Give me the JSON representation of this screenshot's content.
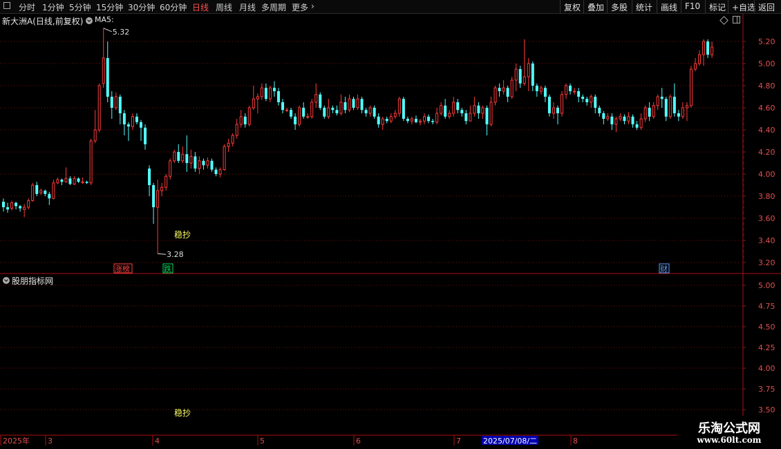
{
  "toolbar": {
    "periods": [
      "分时",
      "1分钟",
      "5分钟",
      "15分钟",
      "30分钟",
      "60分钟",
      "日线",
      "周线",
      "月线",
      "多周期",
      "更多"
    ],
    "active_period": "日线",
    "more_arrow": "›",
    "right_buttons": [
      "复权",
      "叠加",
      "多股",
      "统计",
      "画线",
      "F10",
      "标记",
      "+自选",
      "返回"
    ]
  },
  "main_panel": {
    "title": "新大洲A(日线,前复权)",
    "ma_label": "MA5:",
    "y_ticks": [
      "5.20",
      "5.00",
      "4.80",
      "4.60",
      "4.40",
      "4.20",
      "4.00",
      "3.80",
      "3.60",
      "3.40",
      "3.20"
    ],
    "high_marker": "5.32",
    "low_marker": "3.28",
    "signal_label": "稳抄",
    "badges": [
      {
        "text": "涨榜",
        "color": "#ff4040"
      },
      {
        "text": "跌",
        "color": "#00e060"
      },
      {
        "text": "财",
        "color": "#60a0ff"
      }
    ]
  },
  "sub_panel": {
    "title": "股朋指标网",
    "y_ticks": [
      "5.00",
      "4.75",
      "4.50",
      "4.25",
      "4.00",
      "3.75",
      "3.50"
    ],
    "signal_label": "稳抄"
  },
  "date_axis": {
    "labels": [
      "2025年",
      "3",
      "4",
      "5",
      "6",
      "7",
      "8"
    ],
    "cursor_date": "2025/07/08/二"
  },
  "watermark": {
    "line1": "乐淘公式网",
    "line2": "www.60lt.com"
  },
  "colors": {
    "up": "#ff3c3c",
    "down": "#54ffff",
    "grid": "#7a1010",
    "signal": "#ffff66"
  },
  "chart_data": {
    "type": "candlestick",
    "y_range": [
      3.1,
      5.35
    ],
    "candles": [
      [
        3.75,
        3.7,
        3.78,
        3.66
      ],
      [
        3.7,
        3.68,
        3.74,
        3.65
      ],
      [
        3.69,
        3.74,
        3.76,
        3.67
      ],
      [
        3.74,
        3.71,
        3.75,
        3.68
      ],
      [
        3.71,
        3.69,
        3.72,
        3.66
      ],
      [
        3.68,
        3.7,
        3.73,
        3.61
      ],
      [
        3.7,
        3.76,
        3.78,
        3.68
      ],
      [
        3.76,
        3.9,
        3.92,
        3.75
      ],
      [
        3.9,
        3.82,
        3.93,
        3.8
      ],
      [
        3.83,
        3.85,
        3.87,
        3.81
      ],
      [
        3.85,
        3.82,
        3.86,
        3.8
      ],
      [
        3.82,
        3.78,
        3.84,
        3.72
      ],
      [
        3.78,
        3.92,
        3.95,
        3.77
      ],
      [
        3.92,
        3.95,
        3.97,
        3.91
      ],
      [
        3.95,
        3.93,
        3.96,
        3.9
      ],
      [
        3.93,
        3.96,
        4.06,
        3.92
      ],
      [
        3.96,
        3.91,
        3.98,
        3.9
      ],
      [
        3.91,
        3.96,
        3.98,
        3.9
      ],
      [
        3.96,
        3.93,
        3.97,
        3.92
      ],
      [
        3.93,
        3.93,
        3.97,
        3.91
      ],
      [
        3.93,
        3.92,
        3.94,
        3.91
      ],
      [
        3.92,
        4.3,
        4.32,
        3.9
      ],
      [
        4.3,
        4.4,
        4.58,
        4.28
      ],
      [
        4.4,
        4.8,
        4.82,
        4.38
      ],
      [
        4.82,
        5.05,
        5.32,
        4.78
      ],
      [
        5.05,
        4.7,
        5.2,
        4.65
      ],
      [
        4.7,
        4.6,
        4.75,
        4.5
      ],
      [
        4.6,
        4.7,
        4.74,
        4.58
      ],
      [
        4.7,
        4.55,
        4.72,
        4.45
      ],
      [
        4.55,
        4.45,
        4.58,
        4.35
      ],
      [
        4.45,
        4.43,
        4.47,
        4.3
      ],
      [
        4.43,
        4.52,
        4.55,
        4.4
      ],
      [
        4.52,
        4.47,
        4.55,
        4.45
      ],
      [
        4.47,
        4.42,
        4.49,
        4.3
      ],
      [
        4.42,
        4.27,
        4.45,
        4.22
      ],
      [
        4.05,
        3.9,
        4.08,
        3.8
      ],
      [
        3.9,
        3.7,
        3.92,
        3.55
      ],
      [
        3.7,
        3.85,
        3.95,
        3.28
      ],
      [
        3.85,
        3.88,
        3.92,
        3.8
      ],
      [
        3.88,
        3.98,
        4.0,
        3.85
      ],
      [
        3.98,
        4.12,
        4.14,
        3.95
      ],
      [
        4.12,
        4.2,
        4.22,
        4.1
      ],
      [
        4.2,
        4.12,
        4.27,
        4.1
      ],
      [
        4.12,
        4.18,
        4.25,
        4.1
      ],
      [
        4.18,
        4.1,
        4.35,
        4.02
      ],
      [
        4.1,
        4.16,
        4.22,
        4.05
      ],
      [
        4.16,
        4.05,
        4.2,
        4.02
      ],
      [
        4.05,
        4.12,
        4.16,
        4.0
      ],
      [
        4.12,
        4.08,
        4.14,
        4.04
      ],
      [
        4.08,
        4.12,
        4.15,
        4.05
      ],
      [
        4.12,
        4.04,
        4.14,
        4.02
      ],
      [
        4.04,
        4.0,
        4.06,
        3.98
      ],
      [
        4.0,
        4.04,
        4.06,
        3.97
      ],
      [
        4.04,
        4.25,
        4.27,
        4.03
      ],
      [
        4.25,
        4.28,
        4.32,
        4.2
      ],
      [
        4.28,
        4.35,
        4.37,
        4.25
      ],
      [
        4.35,
        4.45,
        4.5,
        4.32
      ],
      [
        4.45,
        4.52,
        4.58,
        4.42
      ],
      [
        4.52,
        4.45,
        4.55,
        4.42
      ],
      [
        4.45,
        4.6,
        4.62,
        4.43
      ],
      [
        4.6,
        4.68,
        4.8,
        4.58
      ],
      [
        4.68,
        4.7,
        4.73,
        4.55
      ],
      [
        4.7,
        4.78,
        4.82,
        4.67
      ],
      [
        4.78,
        4.68,
        4.82,
        4.66
      ],
      [
        4.68,
        4.78,
        4.8,
        4.65
      ],
      [
        4.78,
        4.75,
        4.84,
        4.7
      ],
      [
        4.75,
        4.65,
        4.78,
        4.62
      ],
      [
        4.65,
        4.58,
        4.68,
        4.55
      ],
      [
        4.58,
        4.58,
        4.6,
        4.56
      ],
      [
        4.58,
        4.52,
        4.6,
        4.5
      ],
      [
        4.52,
        4.45,
        4.55,
        4.4
      ],
      [
        4.45,
        4.6,
        4.62,
        4.43
      ],
      [
        4.6,
        4.52,
        4.65,
        4.5
      ],
      [
        4.52,
        4.52,
        4.55,
        4.5
      ],
      [
        4.52,
        4.65,
        4.68,
        4.5
      ],
      [
        4.65,
        4.72,
        4.82,
        4.6
      ],
      [
        4.72,
        4.6,
        4.74,
        4.58
      ],
      [
        4.6,
        4.52,
        4.62,
        4.5
      ],
      [
        4.52,
        4.6,
        4.68,
        4.5
      ],
      [
        4.6,
        4.58,
        4.62,
        4.55
      ],
      [
        4.58,
        4.55,
        4.62,
        4.53
      ],
      [
        4.55,
        4.65,
        4.72,
        4.53
      ],
      [
        4.65,
        4.58,
        4.7,
        4.55
      ],
      [
        4.58,
        4.68,
        4.72,
        4.56
      ],
      [
        4.68,
        4.6,
        4.7,
        4.58
      ],
      [
        4.6,
        4.68,
        4.72,
        4.58
      ],
      [
        4.68,
        4.58,
        4.7,
        4.55
      ],
      [
        4.58,
        4.55,
        4.6,
        4.52
      ],
      [
        4.55,
        4.6,
        4.62,
        4.52
      ],
      [
        4.6,
        4.52,
        4.62,
        4.5
      ],
      [
        4.52,
        4.45,
        4.55,
        4.42
      ],
      [
        4.45,
        4.5,
        4.52,
        4.4
      ],
      [
        4.5,
        4.48,
        4.52,
        4.46
      ],
      [
        4.48,
        4.52,
        4.55,
        4.46
      ],
      [
        4.52,
        4.55,
        4.58,
        4.5
      ],
      [
        4.55,
        4.68,
        4.7,
        4.52
      ],
      [
        4.68,
        4.5,
        4.7,
        4.48
      ],
      [
        4.5,
        4.48,
        4.52,
        4.46
      ],
      [
        4.48,
        4.5,
        4.52,
        4.45
      ],
      [
        4.5,
        4.47,
        4.53,
        4.46
      ],
      [
        4.47,
        4.48,
        4.5,
        4.44
      ],
      [
        4.48,
        4.52,
        4.55,
        4.45
      ],
      [
        4.52,
        4.48,
        4.54,
        4.46
      ],
      [
        4.48,
        4.47,
        4.5,
        4.45
      ],
      [
        4.47,
        4.55,
        4.6,
        4.45
      ],
      [
        4.55,
        4.62,
        4.65,
        4.53
      ],
      [
        4.62,
        4.52,
        4.68,
        4.5
      ],
      [
        4.52,
        4.55,
        4.58,
        4.5
      ],
      [
        4.55,
        4.65,
        4.7,
        4.52
      ],
      [
        4.65,
        4.58,
        4.68,
        4.55
      ],
      [
        4.58,
        4.55,
        4.6,
        4.52
      ],
      [
        4.55,
        4.48,
        4.58,
        4.45
      ],
      [
        4.48,
        4.55,
        4.62,
        4.48
      ],
      [
        4.55,
        4.62,
        4.7,
        4.52
      ],
      [
        4.62,
        4.55,
        4.65,
        4.5
      ],
      [
        4.55,
        4.6,
        4.62,
        4.5
      ],
      [
        4.6,
        4.45,
        4.62,
        4.35
      ],
      [
        4.45,
        4.65,
        4.7,
        4.43
      ],
      [
        4.65,
        4.78,
        4.8,
        4.62
      ],
      [
        4.78,
        4.75,
        4.82,
        4.7
      ],
      [
        4.75,
        4.78,
        4.85,
        4.72
      ],
      [
        4.78,
        4.7,
        4.8,
        4.65
      ],
      [
        4.7,
        4.85,
        4.88,
        4.68
      ],
      [
        4.85,
        4.95,
        5.0,
        4.75
      ],
      [
        4.95,
        4.82,
        4.98,
        4.78
      ],
      [
        4.82,
        4.88,
        5.22,
        4.8
      ],
      [
        4.88,
        5.0,
        5.05,
        4.75
      ],
      [
        5.0,
        4.8,
        5.02,
        4.75
      ],
      [
        4.8,
        4.75,
        4.82,
        4.7
      ],
      [
        4.75,
        4.78,
        4.8,
        4.72
      ],
      [
        4.78,
        4.7,
        4.8,
        4.65
      ],
      [
        4.7,
        4.55,
        4.72,
        4.52
      ],
      [
        4.55,
        4.6,
        4.65,
        4.5
      ],
      [
        4.6,
        4.55,
        4.62,
        4.45
      ],
      [
        4.55,
        4.72,
        4.75,
        4.52
      ],
      [
        4.72,
        4.8,
        4.82,
        4.68
      ],
      [
        4.8,
        4.75,
        4.82,
        4.72
      ],
      [
        4.75,
        4.75,
        4.78,
        4.72
      ],
      [
        4.75,
        4.7,
        4.78,
        4.65
      ],
      [
        4.7,
        4.68,
        4.72,
        4.65
      ],
      [
        4.68,
        4.65,
        4.7,
        4.62
      ],
      [
        4.65,
        4.7,
        4.72,
        4.6
      ],
      [
        4.7,
        4.6,
        4.72,
        4.55
      ],
      [
        4.6,
        4.55,
        4.62,
        4.52
      ],
      [
        4.55,
        4.5,
        4.57,
        4.45
      ],
      [
        4.5,
        4.52,
        4.55,
        4.48
      ],
      [
        4.52,
        4.45,
        4.55,
        4.4
      ],
      [
        4.45,
        4.5,
        4.52,
        4.38
      ],
      [
        4.5,
        4.52,
        4.55,
        4.48
      ],
      [
        4.52,
        4.48,
        4.54,
        4.45
      ],
      [
        4.48,
        4.52,
        4.56,
        4.45
      ],
      [
        4.52,
        4.45,
        4.54,
        4.42
      ],
      [
        4.45,
        4.42,
        4.48,
        4.4
      ],
      [
        4.42,
        4.5,
        4.55,
        4.4
      ],
      [
        4.5,
        4.6,
        4.62,
        4.47
      ],
      [
        4.6,
        4.52,
        4.65,
        4.48
      ],
      [
        4.52,
        4.62,
        4.65,
        4.5
      ],
      [
        4.62,
        4.7,
        4.72,
        4.58
      ],
      [
        4.7,
        4.68,
        4.78,
        4.6
      ],
      [
        4.68,
        4.52,
        4.7,
        4.48
      ],
      [
        4.52,
        4.7,
        4.72,
        4.5
      ],
      [
        4.7,
        4.55,
        4.82,
        4.52
      ],
      [
        4.55,
        4.52,
        4.58,
        4.48
      ],
      [
        4.52,
        4.6,
        4.65,
        4.5
      ],
      [
        4.6,
        4.62,
        4.65,
        4.48
      ],
      [
        4.62,
        4.95,
        4.98,
        4.6
      ],
      [
        4.95,
        5.0,
        5.05,
        4.93
      ],
      [
        5.0,
        5.08,
        5.12,
        4.98
      ],
      [
        5.08,
        5.2,
        5.22,
        4.98
      ],
      [
        5.2,
        5.08,
        5.22,
        5.05
      ],
      [
        5.08,
        5.15,
        5.2,
        5.05
      ]
    ]
  }
}
